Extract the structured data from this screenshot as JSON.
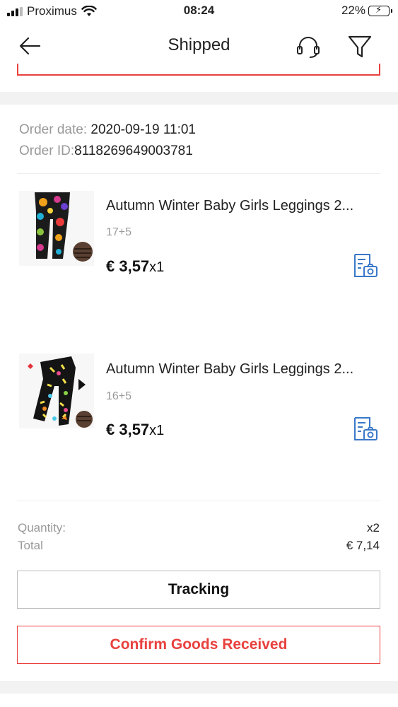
{
  "status_bar": {
    "carrier": "Proximus",
    "time": "08:24",
    "battery": "22%"
  },
  "nav": {
    "title": "Shipped",
    "icons": [
      "back-arrow-icon",
      "customer-service-headset-icon",
      "filter-funnel-icon"
    ]
  },
  "order": {
    "date_label": "Order date:",
    "date_value": "2020-09-19 11:01",
    "id_label": "Order ID:",
    "id_value": "8118269649003781"
  },
  "items": [
    {
      "name": "Autumn Winter Baby Girls Leggings 2...",
      "sku": "17+5",
      "price": "€ 3,57",
      "qty": "x1"
    },
    {
      "name": "Autumn Winter Baby Girls Leggings 2...",
      "sku": "16+5",
      "price": "€ 3,57",
      "qty": "x1"
    }
  ],
  "summary": {
    "quantity_label": "Quantity:",
    "quantity_value": "x2",
    "total_label": "Total",
    "total_value": "€ 7,14"
  },
  "buttons": {
    "tracking": "Tracking",
    "confirm": "Confirm Goods Received"
  },
  "colors": {
    "accent_red": "#e8413e",
    "icon_blue": "#3a78c9",
    "muted_text": "#999999"
  }
}
